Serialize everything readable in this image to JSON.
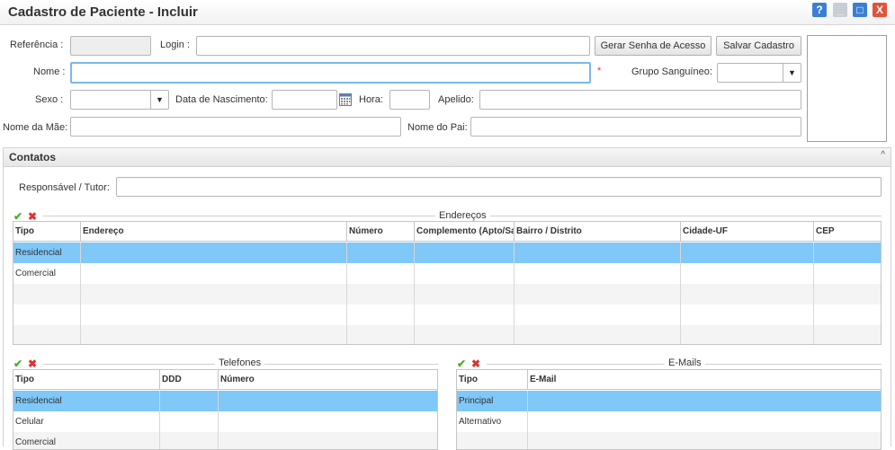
{
  "window": {
    "title": "Cadastro de Paciente - Incluir",
    "help_icon": "?",
    "minimize_icon": "_",
    "maximize_icon": "□",
    "close_icon": "X"
  },
  "form": {
    "referencia_label": "Referência :",
    "login_label": "Login :",
    "gerar_senha_button": "Gerar Senha de Acesso",
    "salvar_button": "Salvar Cadastro",
    "nome_label": "Nome :",
    "required_marker": "*",
    "grupo_sanguineo_label": "Grupo Sanguíneo:",
    "sexo_label": "Sexo :",
    "data_nascimento_label": "Data de Nascimento:",
    "hora_label": "Hora:",
    "apelido_label": "Apelido:",
    "nome_mae_label": "Nome da Mãe:",
    "nome_pai_label": "Nome do Pai:"
  },
  "contatos": {
    "title": "Contatos",
    "collapse_icon": "^",
    "responsavel_label": "Responsável / Tutor:"
  },
  "enderecos": {
    "legend": "Endereços",
    "columns": [
      "Tipo",
      "Endereço",
      "Número",
      "Complemento (Apto/Sala)",
      "Bairro / Distrito",
      "Cidade-UF",
      "CEP"
    ],
    "rows": [
      "Residencial",
      "Comercial",
      "",
      "",
      ""
    ]
  },
  "telefones": {
    "legend": "Telefones",
    "columns": [
      "Tipo",
      "DDD",
      "Número"
    ],
    "rows": [
      "Residencial",
      "Celular",
      "Comercial"
    ]
  },
  "emails": {
    "legend": "E-Mails",
    "columns": [
      "Tipo",
      "E-Mail"
    ],
    "rows": [
      "Principal",
      "Alternativo",
      ""
    ]
  },
  "icons": {
    "ok": "✔",
    "delete": "✖",
    "dropdown": "▼",
    "calendar": "calendar-icon"
  },
  "colors": {
    "selected_row": "#7fc8f8",
    "focus_border": "#7ab9e8",
    "ok_green": "#4caf2a",
    "delete_red": "#d33"
  }
}
